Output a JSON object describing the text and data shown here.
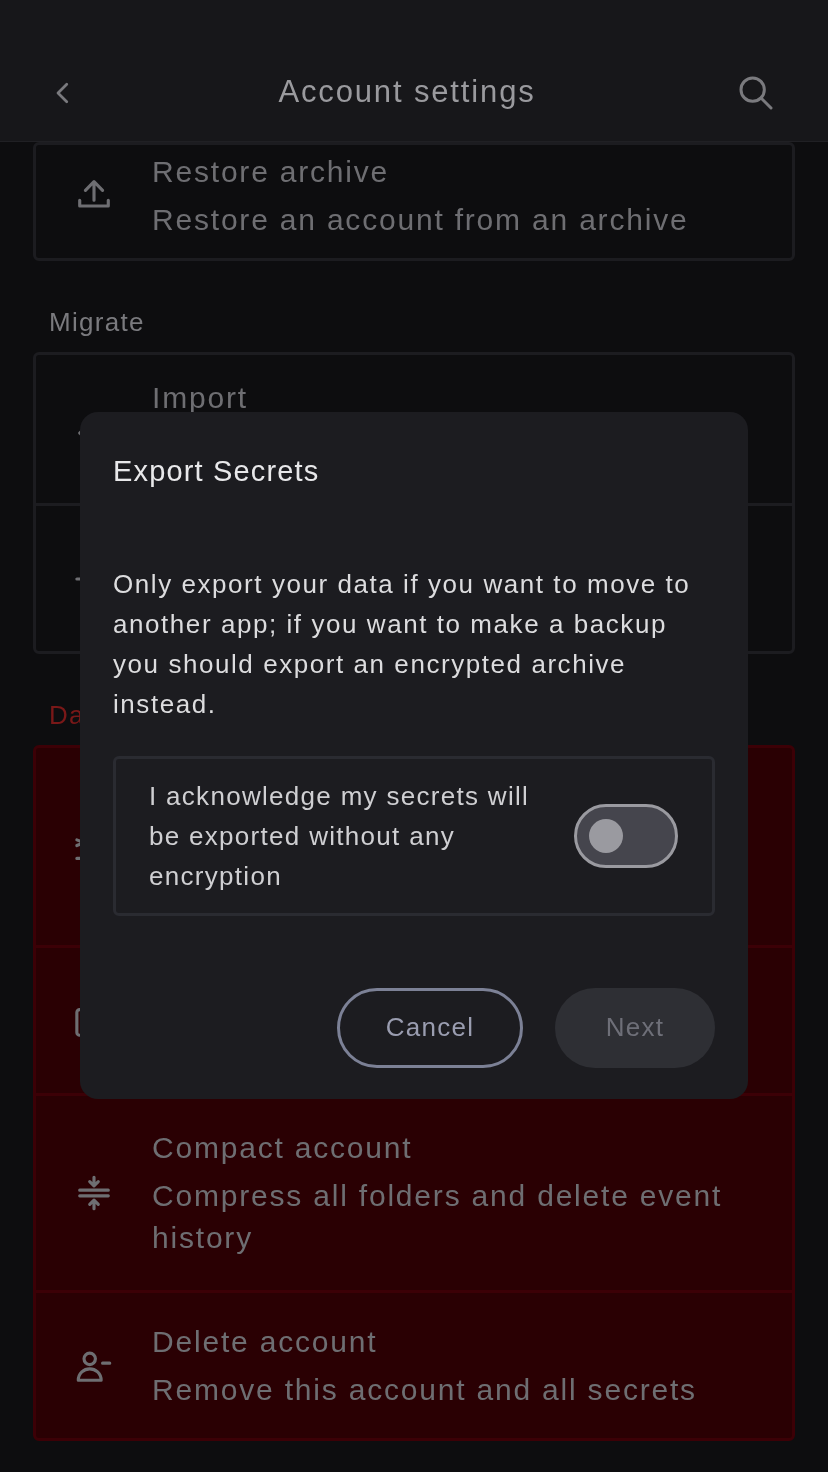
{
  "header": {
    "title": "Account settings"
  },
  "sections": [
    {
      "danger": false,
      "rows": [
        {
          "title": "Restore archive",
          "subtitle": "Restore an account from an archive"
        }
      ]
    },
    {
      "heading": "Migrate",
      "danger": false,
      "rows": [
        {
          "title": "Import"
        },
        {}
      ]
    },
    {
      "heading": "Da",
      "danger": true,
      "rows": [
        {},
        {},
        {
          "title": "Compact account",
          "subtitle": "Compress all folders and delete event history"
        },
        {
          "title": "Delete account",
          "subtitle": "Remove this account and all secrets"
        }
      ]
    }
  ],
  "dialog": {
    "title": "Export Secrets",
    "message": "Only export your data if you want to move to another app; if you want to make a backup you should export an encrypted archive instead.",
    "acknowledge": {
      "label": "I acknowledge my secrets will be exported without any encryption",
      "checked": false
    },
    "buttons": [
      {
        "label": "Cancel",
        "kind": "outline",
        "disabled": false
      },
      {
        "label": "Next",
        "kind": "filled",
        "disabled": true
      }
    ]
  }
}
